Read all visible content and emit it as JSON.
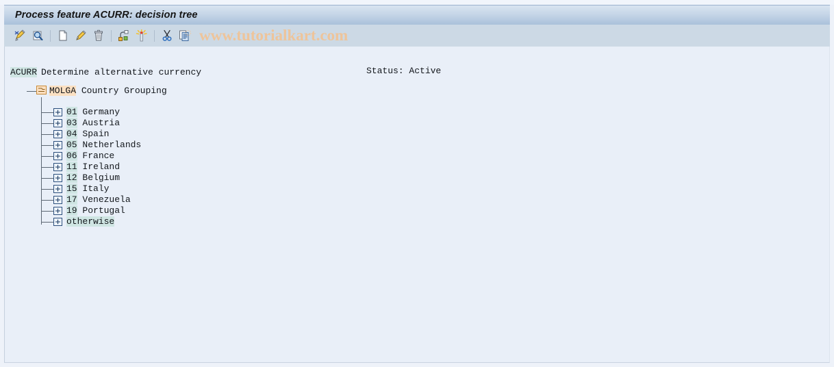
{
  "window": {
    "title": "Process feature ACURR: decision tree"
  },
  "toolbar": {
    "watermark": "www.tutorialkart.com",
    "buttons": [
      {
        "name": "edit-pencil-icon",
        "title": "Change"
      },
      {
        "name": "display-magnifier-icon",
        "title": "Display"
      },
      {
        "name": "new-document-icon",
        "title": "Create"
      },
      {
        "name": "change-pencil-icon",
        "title": "Change node"
      },
      {
        "name": "delete-trash-icon",
        "title": "Delete"
      },
      {
        "name": "node-structure-icon",
        "title": "Insert node"
      },
      {
        "name": "highlight-star-icon",
        "title": "Highlight"
      },
      {
        "name": "cut-scissors-icon",
        "title": "Cut"
      },
      {
        "name": "copy-paste-icon",
        "title": "Copy"
      }
    ]
  },
  "header": {
    "feature_code": "ACURR",
    "feature_description": "Determine alternative currency",
    "status_label": "Status: Active"
  },
  "tree": {
    "root": {
      "code": "MOLGA",
      "description": "Country Grouping"
    },
    "nodes": [
      {
        "code": "01",
        "label": "Germany"
      },
      {
        "code": "03",
        "label": "Austria"
      },
      {
        "code": "04",
        "label": "Spain"
      },
      {
        "code": "05",
        "label": "Netherlands"
      },
      {
        "code": "06",
        "label": "France"
      },
      {
        "code": "11",
        "label": "Ireland"
      },
      {
        "code": "12",
        "label": "Belgium"
      },
      {
        "code": "15",
        "label": "Italy"
      },
      {
        "code": "17",
        "label": "Venezuela"
      },
      {
        "code": "19",
        "label": "Portugal"
      },
      {
        "code": "",
        "label": "otherwise"
      }
    ]
  },
  "colors": {
    "title_bar_top": "#d9e4f0",
    "title_bar_bottom": "#aac1da",
    "toolbar_bg": "#ccd9e5",
    "content_bg": "#e9eff8",
    "code_highlight_cyan": "#cfe5e3",
    "code_highlight_orange": "#fbe0c2",
    "watermark": "#eec49a"
  }
}
